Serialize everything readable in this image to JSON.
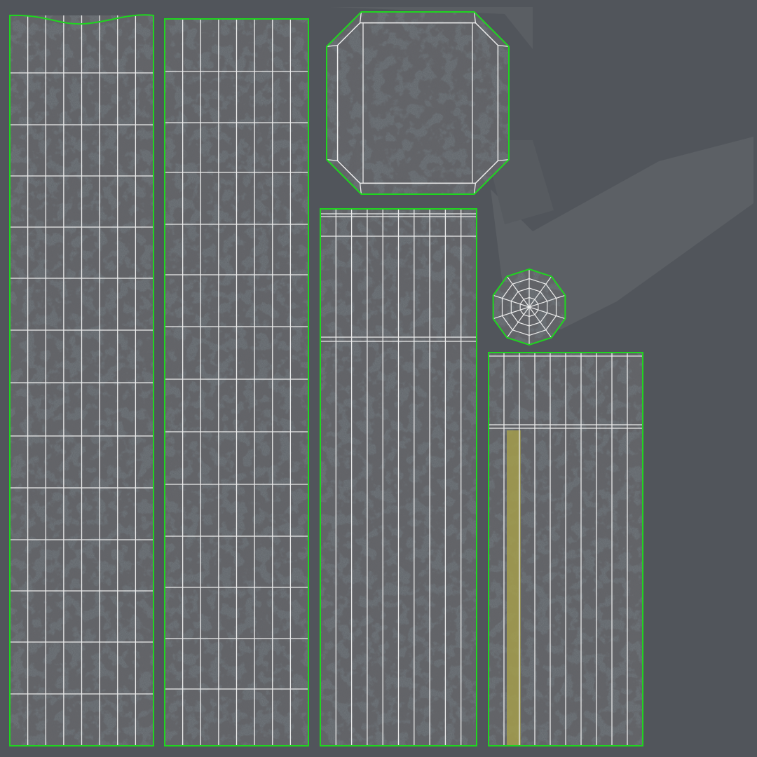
{
  "viewport": {
    "background_color": "#51555b",
    "texture_color": "#5f6469",
    "texture_dark_color": "#3e4246",
    "grime_color": "#2a2b2c",
    "wire_color": "#ececec",
    "island_outline_color": "#1fd61f",
    "selected_face_color": "#a7a04a"
  },
  "uv_islands": [
    {
      "name": "uv-island-left-strip",
      "shape": "grid",
      "columns": 8,
      "rows": 14
    },
    {
      "name": "uv-island-second-strip",
      "shape": "grid",
      "columns": 8,
      "rows": 14
    },
    {
      "name": "uv-island-cap-octagon",
      "shape": "octagon-cap",
      "columns": 1,
      "rows": 1
    },
    {
      "name": "uv-island-tall-strip",
      "shape": "grid",
      "columns": 10,
      "rows": 1
    },
    {
      "name": "uv-island-small-radial",
      "shape": "radial",
      "segments": 10,
      "rings": 4
    },
    {
      "name": "uv-island-right-strip",
      "shape": "grid",
      "columns": 10,
      "rows": 1
    }
  ]
}
